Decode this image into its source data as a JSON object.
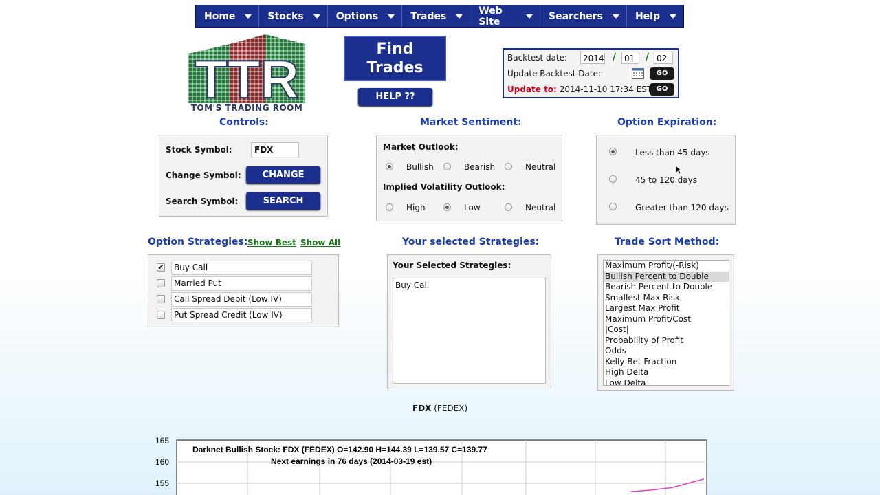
{
  "nav": {
    "items": [
      "Home",
      "Stocks",
      "Options",
      "Trades",
      "Web Site",
      "Searchers",
      "Help"
    ]
  },
  "logo": {
    "letters": "TTR",
    "caption": "TOM'S TRADING ROOM"
  },
  "find_trades": {
    "line1": "Find",
    "line2": "Trades",
    "help": "HELP ??"
  },
  "backtest": {
    "date_label": "Backtest date:",
    "year": "2014",
    "month": "01",
    "day": "02",
    "sep": "/",
    "update_label": "Update Backtest Date:",
    "update_to_label": "Update to:",
    "update_to_value": "2014-11-10 17:34 EST",
    "go": "GO"
  },
  "controls": {
    "heading": "Controls:",
    "stock_symbol_label": "Stock Symbol:",
    "stock_symbol_value": "FDX",
    "change_label": "Change Symbol:",
    "change_btn": "CHANGE",
    "search_label": "Search Symbol:",
    "search_btn": "SEARCH"
  },
  "sentiment": {
    "heading": "Market Sentiment:",
    "outlook_label": "Market Outlook:",
    "outlook_options": [
      "Bullish",
      "Bearish",
      "Neutral"
    ],
    "outlook_selected": "Bullish",
    "iv_label": "Implied Volatility Outlook:",
    "iv_options": [
      "High",
      "Low",
      "Neutral"
    ],
    "iv_selected": "Low"
  },
  "expiration": {
    "heading": "Option Expiration:",
    "options": [
      "Less than 45 days",
      "45 to 120 days",
      "Greater than 120 days"
    ],
    "selected": "Less than 45 days"
  },
  "strategies": {
    "heading": "Option Strategies:",
    "show_best": "Show Best",
    "show_all": "Show All",
    "items": [
      {
        "label": "Buy Call",
        "checked": true
      },
      {
        "label": "Married Put",
        "checked": false
      },
      {
        "label": "Call Spread Debit (Low IV)",
        "checked": false
      },
      {
        "label": "Put Spread Credit (Low IV)",
        "checked": false
      }
    ]
  },
  "selected_strategies": {
    "heading": "Your selected Strategies:",
    "box_label": "Your Selected Strategies:",
    "text": "Buy Call"
  },
  "sort": {
    "heading": "Trade Sort Method:",
    "options": [
      "Maximum Profit/(-Risk)",
      "Bullish Percent to Double",
      "Bearish Percent to Double",
      "Smallest Max Risk",
      "Largest Max Profit",
      "Maximum Profit/Cost",
      "|Cost|",
      "Probability of Profit",
      "Odds",
      "Kelly Bet Fraction",
      "High Delta",
      "Low Delta"
    ],
    "selected": "Bullish Percent to Double"
  },
  "chart_title": {
    "symbol": "FDX",
    "name": "(FEDEX)"
  },
  "chart_data": {
    "type": "line",
    "title": "Darknet Bullish Stock: FDX (FEDEX) O=142.90  H=144.39  L=139.57  C=139.77",
    "subtitle": "Next earnings in 76 days  (2014-03-19 est)",
    "y_ticks": [
      "165",
      "160",
      "155"
    ],
    "ylim": [
      150,
      165
    ],
    "xlabel": "",
    "ylabel": "",
    "series": [
      {
        "color": "#e040c0",
        "x": [
          0.86,
          0.9,
          0.94,
          0.97,
          1.0
        ],
        "values": [
          153.0,
          153.4,
          154.0,
          155.0,
          156.0
        ]
      }
    ],
    "grid": true
  }
}
